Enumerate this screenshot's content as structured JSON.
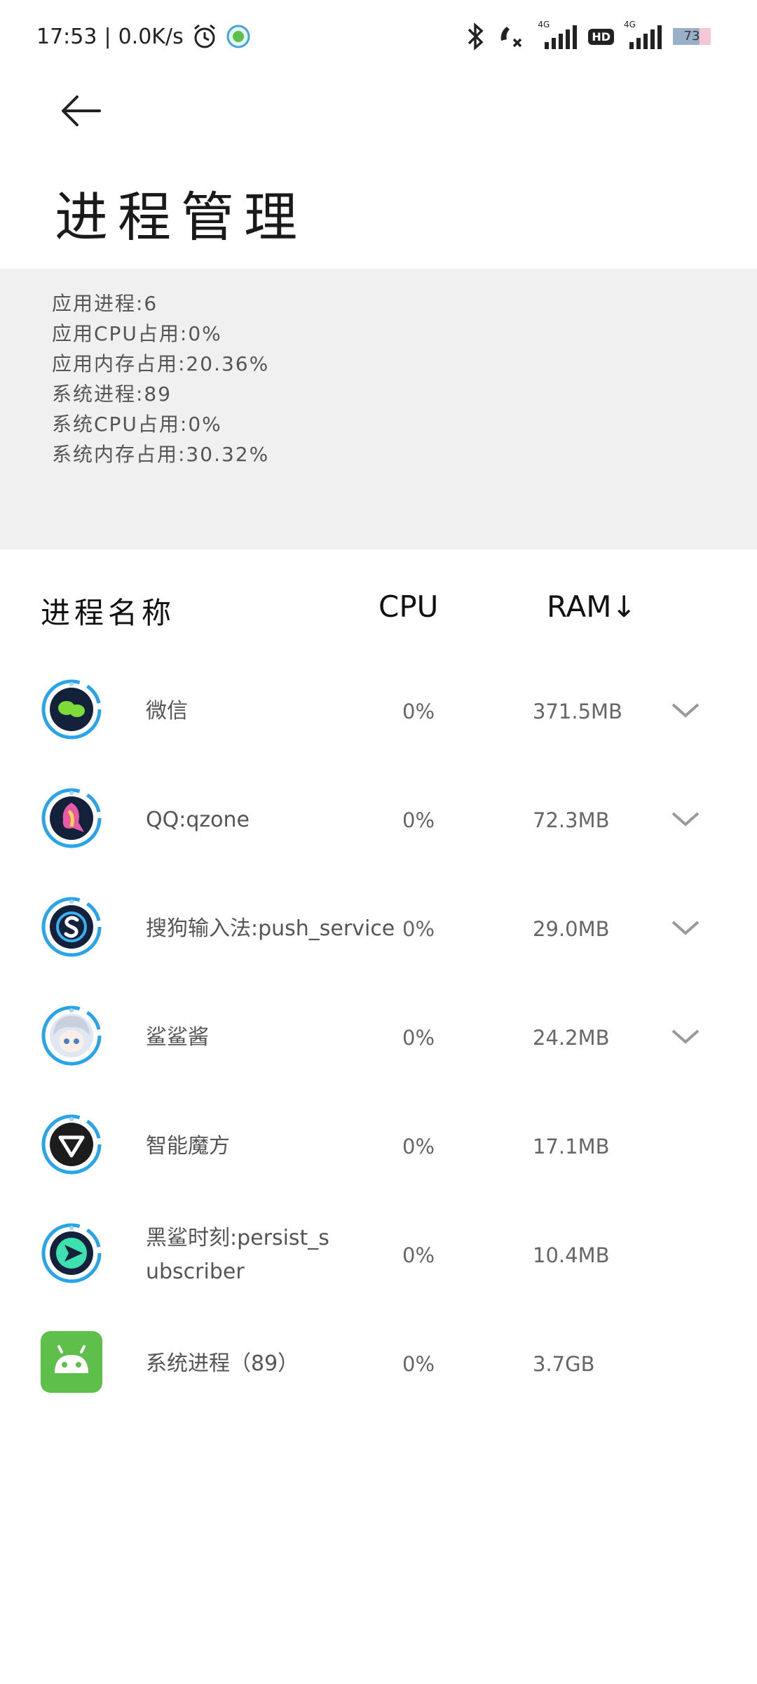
{
  "status_bar": {
    "time": "17:53",
    "separator": "|",
    "net_speed": "0.0K/s",
    "battery": "73",
    "net_label_1": "4G",
    "net_label_2": "4G",
    "hd_label": "HD",
    "icons": [
      "alarm-icon",
      "app-notification-icon",
      "bluetooth-icon",
      "call-muted-icon",
      "signal-icon",
      "hd-icon",
      "battery-icon"
    ]
  },
  "page": {
    "title": "进程管理"
  },
  "summary": {
    "app_process": "应用进程:6",
    "app_cpu": "应用CPU占用:0%",
    "app_mem": "应用内存占用:20.36%",
    "sys_process": "系统进程:89",
    "sys_cpu": "系统CPU占用:0%",
    "sys_mem": "系统内存占用:30.32%"
  },
  "table_header": {
    "name": "进程名称",
    "cpu": "CPU",
    "ram": "RAM↓"
  },
  "processes": [
    {
      "name": "微信",
      "cpu": "0%",
      "ram": "371.5MB",
      "expandable": true,
      "icon": "wechat-icon"
    },
    {
      "name": "QQ:qzone",
      "cpu": "0%",
      "ram": "72.3MB",
      "expandable": true,
      "icon": "qq-icon"
    },
    {
      "name": "搜狗输入法:push_service",
      "cpu": "0%",
      "ram": "29.0MB",
      "expandable": true,
      "icon": "sogou-icon"
    },
    {
      "name": "鲨鲨酱",
      "cpu": "0%",
      "ram": "24.2MB",
      "expandable": true,
      "icon": "anime-avatar-icon"
    },
    {
      "name": "智能魔方",
      "cpu": "0%",
      "ram": "17.1MB",
      "expandable": false,
      "icon": "magic-cube-icon"
    },
    {
      "name": "黑鲨时刻:persist_subscriber",
      "cpu": "0%",
      "ram": "10.4MB",
      "expandable": false,
      "icon": "play-icon"
    },
    {
      "name": "系统进程（89）",
      "cpu": "0%",
      "ram": "3.7GB",
      "expandable": false,
      "icon": "android-icon"
    }
  ],
  "colors": {
    "ring": "#2aa4e8",
    "android_green": "#5ec04a",
    "summary_bg": "#f0f0f0"
  }
}
